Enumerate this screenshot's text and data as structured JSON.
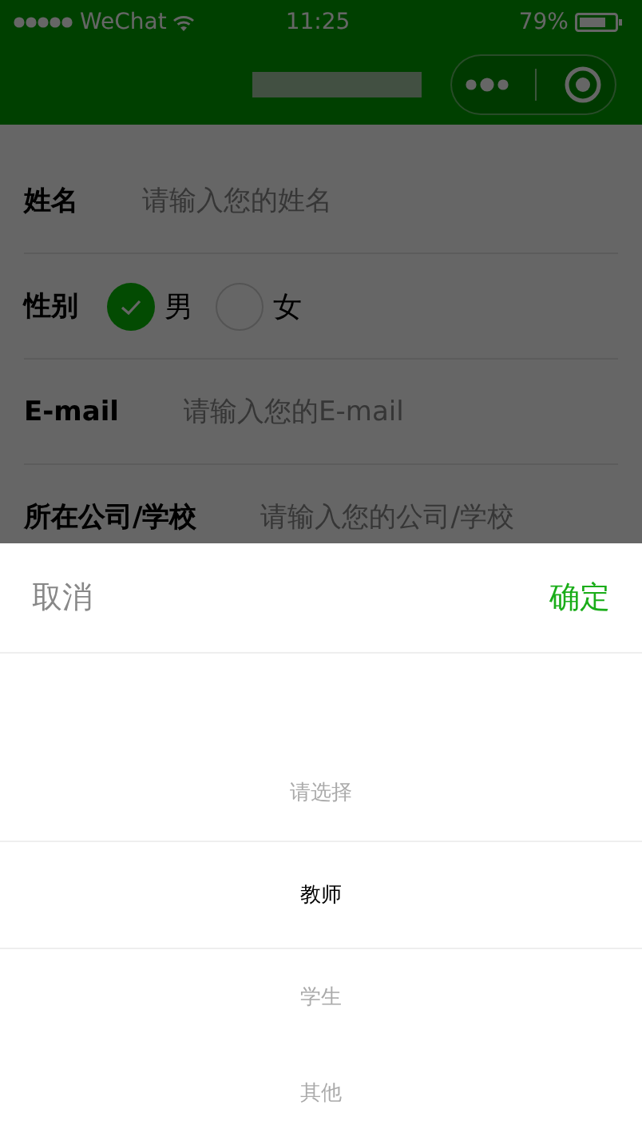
{
  "status_bar": {
    "carrier": "WeChat",
    "time": "11:25",
    "battery": "79%"
  },
  "form": {
    "fields": [
      {
        "kind": "input",
        "label": "姓名",
        "placeholder": "请输入您的姓名"
      },
      {
        "kind": "radio",
        "label": "性别",
        "options": [
          {
            "label": "男",
            "selected": true
          },
          {
            "label": "女",
            "selected": false
          }
        ]
      },
      {
        "kind": "input",
        "label": "E-mail",
        "placeholder": "请输入您的E-mail"
      },
      {
        "kind": "input",
        "label": "所在公司/学校",
        "placeholder": "请输入您的公司/学校"
      }
    ]
  },
  "picker": {
    "cancel": "取消",
    "confirm": "确定",
    "options": [
      {
        "label": "请选择",
        "selected": false
      },
      {
        "label": "教师",
        "selected": true
      },
      {
        "label": "学生",
        "selected": false
      },
      {
        "label": "其他",
        "selected": false
      }
    ]
  }
}
